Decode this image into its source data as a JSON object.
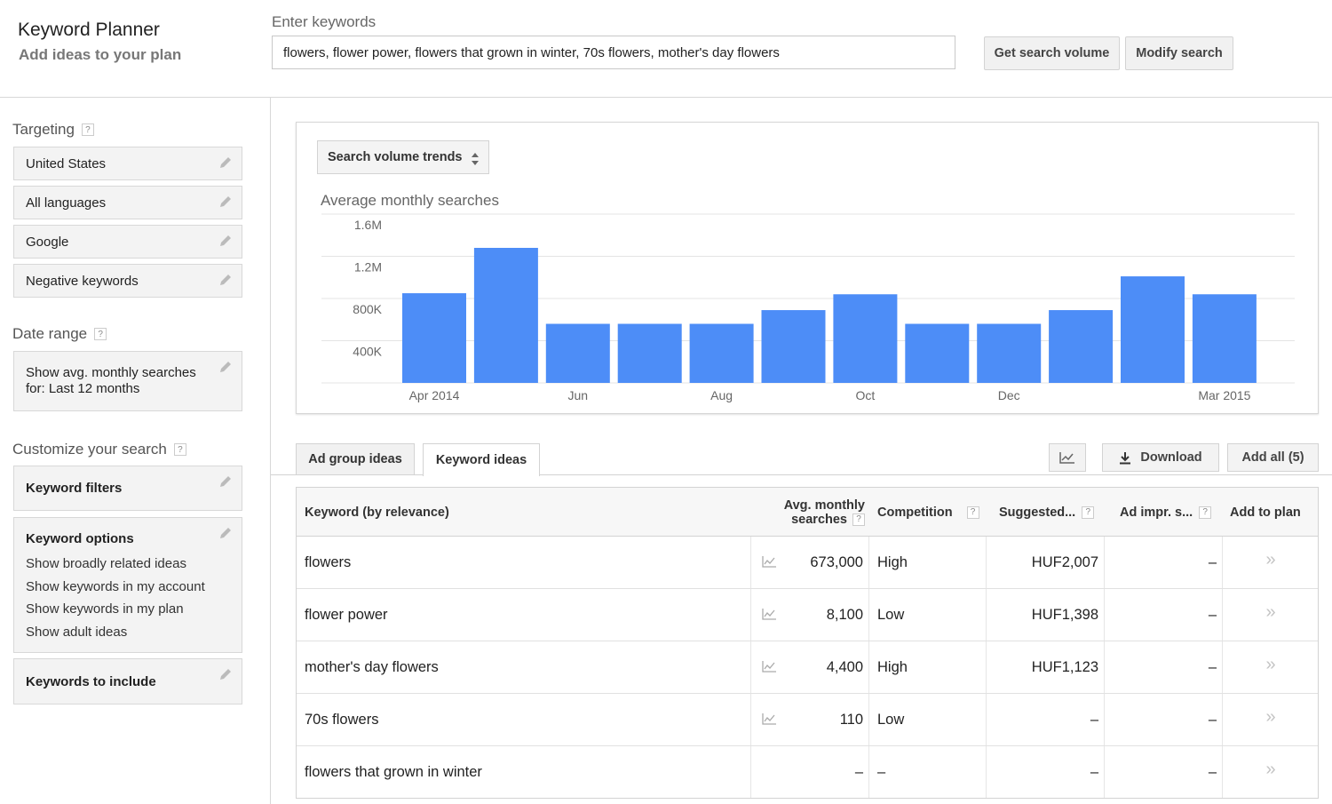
{
  "header": {
    "title": "Keyword Planner",
    "subtitle": "Add ideas to your plan",
    "keywords_label": "Enter keywords",
    "keywords_value": "flowers, flower power, flowers that grown in winter, 70s flowers, mother's day flowers",
    "get_volume_button": "Get search volume",
    "modify_button": "Modify search"
  },
  "sidebar": {
    "targeting_label": "Targeting",
    "targeting_items": [
      "United States",
      "All languages",
      "Google",
      "Negative keywords"
    ],
    "date_range_label": "Date range",
    "date_range_line1": "Show avg. monthly searches",
    "date_range_line2": "for: Last 12 months",
    "customize_label": "Customize your search",
    "keyword_filters": "Keyword filters",
    "keyword_options": {
      "title": "Keyword options",
      "lines": [
        "Show broadly related ideas",
        "Show keywords in my account",
        "Show keywords in my plan",
        "Show adult ideas"
      ]
    },
    "keywords_to_include": "Keywords to include",
    "help_glyph": "?"
  },
  "chart": {
    "selector_label": "Search volume trends",
    "heading": "Average monthly searches"
  },
  "chart_data": {
    "type": "bar",
    "title": "Average monthly searches",
    "categories": [
      "Apr 2014",
      "May 2014",
      "Jun 2014",
      "Jul 2014",
      "Aug 2014",
      "Sep 2014",
      "Oct 2014",
      "Nov 2014",
      "Dec 2014",
      "Jan 2015",
      "Feb 2015",
      "Mar 2015"
    ],
    "x_tick_labels": [
      "Apr 2014",
      "Jun",
      "Aug",
      "Oct",
      "Dec",
      "Mar 2015"
    ],
    "x_tick_indices": [
      0,
      2,
      4,
      6,
      8,
      11
    ],
    "y_tick_labels": [
      "400K",
      "800K",
      "1.2M",
      "1.6M"
    ],
    "y_ticks": [
      400000,
      800000,
      1200000,
      1600000
    ],
    "values": [
      850000,
      1280000,
      560000,
      560000,
      560000,
      690000,
      840000,
      560000,
      560000,
      690000,
      1010000,
      840000
    ],
    "ylim": [
      0,
      1600000
    ],
    "grid": true,
    "bar_color": "#4d8df7"
  },
  "tabs": {
    "ad_group": "Ad group ideas",
    "keyword": "Keyword ideas",
    "download": "Download",
    "add_all": "Add all (5)"
  },
  "table": {
    "headers": {
      "keyword": "Keyword (by relevance)",
      "avg_line1": "Avg. monthly",
      "avg_line2": "searches",
      "competition": "Competition",
      "suggested": "Suggested...",
      "ad_impr": "Ad impr. s...",
      "add_to_plan": "Add to plan"
    },
    "rows": [
      {
        "keyword": "flowers",
        "searches": "673,000",
        "competition": "High",
        "bid": "HUF2,007",
        "impr": "–",
        "add": "»"
      },
      {
        "keyword": "flower power",
        "searches": "8,100",
        "competition": "Low",
        "bid": "HUF1,398",
        "impr": "–",
        "add": "»"
      },
      {
        "keyword": "mother's day flowers",
        "searches": "4,400",
        "competition": "High",
        "bid": "HUF1,123",
        "impr": "–",
        "add": "»"
      },
      {
        "keyword": "70s flowers",
        "searches": "110",
        "competition": "Low",
        "bid": "–",
        "impr": "–",
        "add": "»"
      },
      {
        "keyword": "flowers that grown in winter",
        "searches": "–",
        "competition": "–",
        "bid": "–",
        "impr": "–",
        "add": "»"
      }
    ]
  },
  "icons": {
    "pencil": "pencil-icon",
    "trend": "trend-chart-icon",
    "download": "download-icon",
    "sort": "sort-arrows-icon"
  }
}
